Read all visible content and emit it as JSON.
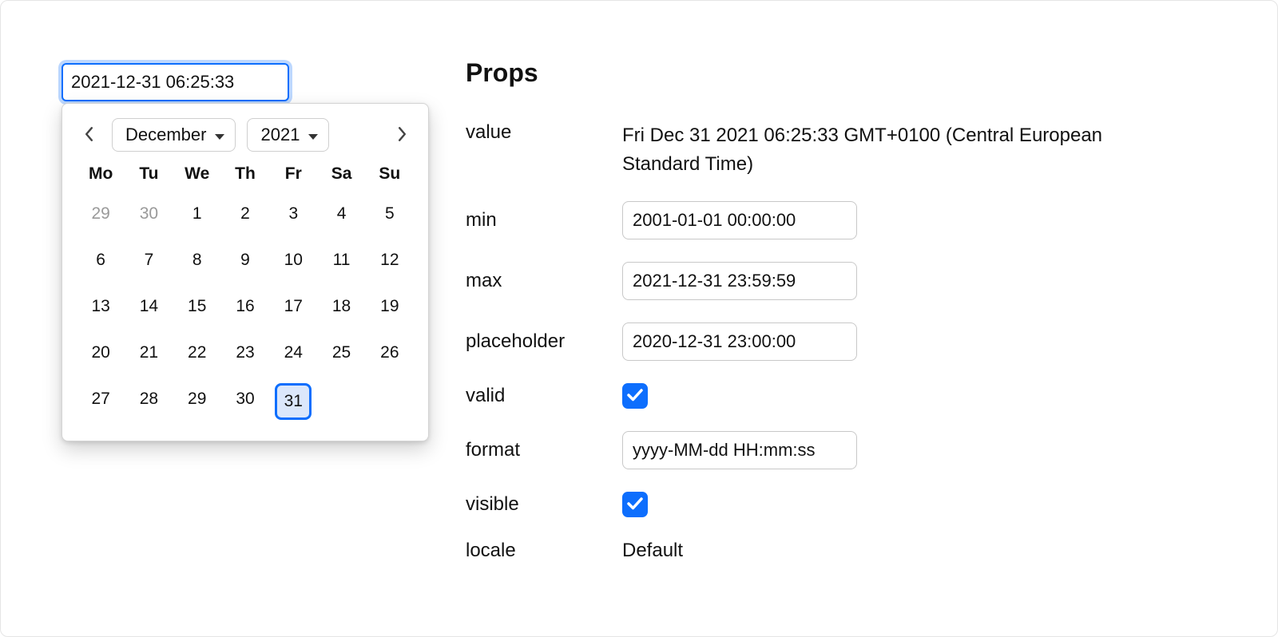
{
  "input": {
    "value": "2021-12-31 06:25:33"
  },
  "calendar": {
    "month": "December",
    "year": "2021",
    "weekdays": [
      "Mo",
      "Tu",
      "We",
      "Th",
      "Fr",
      "Sa",
      "Su"
    ],
    "weeks": [
      [
        {
          "d": "29",
          "muted": true
        },
        {
          "d": "30",
          "muted": true
        },
        {
          "d": "1"
        },
        {
          "d": "2"
        },
        {
          "d": "3"
        },
        {
          "d": "4"
        },
        {
          "d": "5"
        }
      ],
      [
        {
          "d": "6"
        },
        {
          "d": "7"
        },
        {
          "d": "8"
        },
        {
          "d": "9"
        },
        {
          "d": "10"
        },
        {
          "d": "11"
        },
        {
          "d": "12"
        }
      ],
      [
        {
          "d": "13"
        },
        {
          "d": "14"
        },
        {
          "d": "15"
        },
        {
          "d": "16"
        },
        {
          "d": "17"
        },
        {
          "d": "18"
        },
        {
          "d": "19"
        }
      ],
      [
        {
          "d": "20"
        },
        {
          "d": "21"
        },
        {
          "d": "22"
        },
        {
          "d": "23"
        },
        {
          "d": "24"
        },
        {
          "d": "25"
        },
        {
          "d": "26"
        }
      ],
      [
        {
          "d": "27"
        },
        {
          "d": "28"
        },
        {
          "d": "29"
        },
        {
          "d": "30"
        },
        {
          "d": "31",
          "selected": true
        }
      ]
    ]
  },
  "props": {
    "heading": "Props",
    "labels": {
      "value": "value",
      "min": "min",
      "max": "max",
      "placeholder": "placeholder",
      "valid": "valid",
      "format": "format",
      "visible": "visible",
      "locale": "locale"
    },
    "value_text": "Fri Dec 31 2021 06:25:33 GMT+0100 (Central European Standard Time)",
    "min": "2001-01-01 00:00:00",
    "max": "2021-12-31 23:59:59",
    "placeholder": "2020-12-31 23:00:00",
    "valid": true,
    "format": "yyyy-MM-dd HH:mm:ss",
    "visible": true,
    "locale": "Default"
  }
}
